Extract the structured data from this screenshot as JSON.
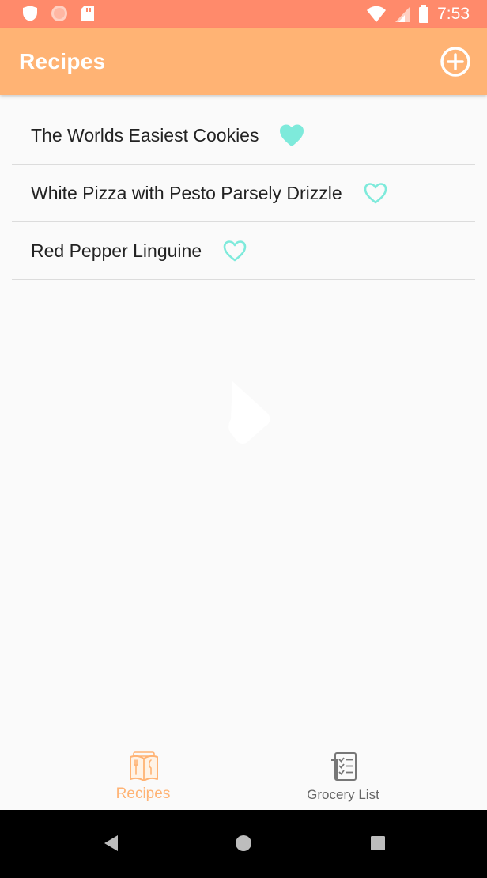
{
  "status_bar": {
    "time": "7:53"
  },
  "app_bar": {
    "title": "Recipes"
  },
  "recipes": [
    {
      "name": "The Worlds Easiest Cookies",
      "favorite": true
    },
    {
      "name": "White Pizza with Pesto Parsely Drizzle",
      "favorite": false
    },
    {
      "name": "Red Pepper Linguine",
      "favorite": false
    }
  ],
  "bottom_nav": {
    "tabs": [
      {
        "label": "Recipes",
        "active": true
      },
      {
        "label": "Grocery List",
        "active": false
      }
    ]
  },
  "colors": {
    "status_bar": "#ff8a6b",
    "app_bar": "#ffb374",
    "heart": "#7eeadb",
    "active_tab": "#ffb374",
    "inactive_tab": "#666666"
  },
  "icons": {
    "add": "plus-circle-icon",
    "favorite": "heart-icon",
    "recipes_tab": "recipe-book-icon",
    "grocery_tab": "checklist-icon"
  }
}
